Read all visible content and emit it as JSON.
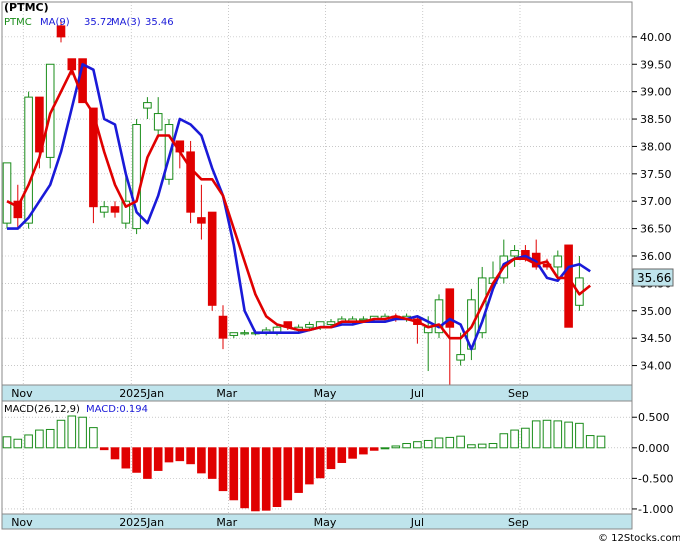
{
  "chart_data": [
    {
      "type": "candlestick",
      "ticker": "(PTMC)",
      "legend": {
        "symbol": "PTMC",
        "ma9_label": "MA(9)",
        "ma9_value": "35.72",
        "ma3_label": "MA(3)",
        "ma3_value": "35.46"
      },
      "last_price": "35.66",
      "ylim": [
        33.7,
        40.6
      ],
      "yticks": [
        "40.00",
        "39.50",
        "39.00",
        "38.50",
        "38.00",
        "37.50",
        "37.00",
        "36.50",
        "36.00",
        "35.50",
        "35.00",
        "34.50",
        "34.00"
      ],
      "month_labels": [
        "Nov",
        "2025Jan",
        "Mar",
        "May",
        "Jul",
        "Sep"
      ],
      "month_positions": [
        1.5,
        11.5,
        20.5,
        29.5,
        38.5,
        47.5
      ],
      "candles": [
        {
          "o": 36.6,
          "h": 37.7,
          "l": 36.5,
          "c": 37.7
        },
        {
          "o": 37.0,
          "h": 37.3,
          "l": 36.5,
          "c": 36.7
        },
        {
          "o": 36.6,
          "h": 39.0,
          "l": 36.5,
          "c": 38.9
        },
        {
          "o": 38.9,
          "h": 38.9,
          "l": 37.6,
          "c": 37.9
        },
        {
          "o": 37.8,
          "h": 39.5,
          "l": 37.6,
          "c": 39.5
        },
        {
          "o": 40.2,
          "h": 40.3,
          "l": 39.9,
          "c": 40.0
        },
        {
          "o": 39.6,
          "h": 39.6,
          "l": 39.3,
          "c": 39.4
        },
        {
          "o": 39.6,
          "h": 39.6,
          "l": 38.8,
          "c": 38.8
        },
        {
          "o": 38.7,
          "h": 38.7,
          "l": 36.6,
          "c": 36.9
        },
        {
          "o": 36.8,
          "h": 37.0,
          "l": 36.7,
          "c": 36.9
        },
        {
          "o": 36.9,
          "h": 37.0,
          "l": 36.7,
          "c": 36.8
        },
        {
          "o": 36.6,
          "h": 37.5,
          "l": 36.5,
          "c": 37.0
        },
        {
          "o": 36.5,
          "h": 38.5,
          "l": 36.4,
          "c": 38.4
        },
        {
          "o": 38.7,
          "h": 38.9,
          "l": 38.5,
          "c": 38.8
        },
        {
          "o": 38.3,
          "h": 38.9,
          "l": 38.2,
          "c": 38.6
        },
        {
          "o": 37.4,
          "h": 38.5,
          "l": 37.3,
          "c": 38.4
        },
        {
          "o": 38.1,
          "h": 38.1,
          "l": 37.6,
          "c": 37.9
        },
        {
          "o": 37.9,
          "h": 38.1,
          "l": 36.6,
          "c": 36.8
        },
        {
          "o": 36.7,
          "h": 37.3,
          "l": 36.3,
          "c": 36.6
        },
        {
          "o": 36.8,
          "h": 36.8,
          "l": 35.0,
          "c": 35.1
        },
        {
          "o": 34.9,
          "h": 35.1,
          "l": 34.3,
          "c": 34.5
        },
        {
          "o": 34.55,
          "h": 34.6,
          "l": 34.5,
          "c": 34.6
        },
        {
          "o": 34.6,
          "h": 34.65,
          "l": 34.55,
          "c": 34.6
        },
        {
          "o": 34.6,
          "h": 34.65,
          "l": 34.55,
          "c": 34.6
        },
        {
          "o": 34.6,
          "h": 34.7,
          "l": 34.55,
          "c": 34.65
        },
        {
          "o": 34.6,
          "h": 34.75,
          "l": 34.55,
          "c": 34.7
        },
        {
          "o": 34.8,
          "h": 34.8,
          "l": 34.65,
          "c": 34.7
        },
        {
          "o": 34.65,
          "h": 34.75,
          "l": 34.6,
          "c": 34.7
        },
        {
          "o": 34.7,
          "h": 34.8,
          "l": 34.65,
          "c": 34.75
        },
        {
          "o": 34.7,
          "h": 34.8,
          "l": 34.65,
          "c": 34.8
        },
        {
          "o": 34.75,
          "h": 34.85,
          "l": 34.7,
          "c": 34.8
        },
        {
          "o": 34.8,
          "h": 34.9,
          "l": 34.75,
          "c": 34.85
        },
        {
          "o": 34.8,
          "h": 34.9,
          "l": 34.75,
          "c": 34.85
        },
        {
          "o": 34.85,
          "h": 34.9,
          "l": 34.8,
          "c": 34.85
        },
        {
          "o": 34.85,
          "h": 34.9,
          "l": 34.8,
          "c": 34.9
        },
        {
          "o": 34.85,
          "h": 34.95,
          "l": 34.8,
          "c": 34.9
        },
        {
          "o": 34.9,
          "h": 34.95,
          "l": 34.8,
          "c": 34.85
        },
        {
          "o": 34.85,
          "h": 34.95,
          "l": 34.8,
          "c": 34.9
        },
        {
          "o": 34.85,
          "h": 34.9,
          "l": 34.4,
          "c": 34.75
        },
        {
          "o": 34.6,
          "h": 34.9,
          "l": 33.9,
          "c": 34.7
        },
        {
          "o": 34.6,
          "h": 35.3,
          "l": 34.5,
          "c": 35.2
        },
        {
          "o": 35.4,
          "h": 35.4,
          "l": 33.6,
          "c": 34.7
        },
        {
          "o": 34.1,
          "h": 34.6,
          "l": 34.0,
          "c": 34.2
        },
        {
          "o": 34.3,
          "h": 35.4,
          "l": 34.1,
          "c": 35.2
        },
        {
          "o": 34.6,
          "h": 35.8,
          "l": 34.5,
          "c": 35.6
        },
        {
          "o": 35.5,
          "h": 35.9,
          "l": 35.4,
          "c": 35.6
        },
        {
          "o": 35.6,
          "h": 36.3,
          "l": 35.5,
          "c": 36.0
        },
        {
          "o": 36.0,
          "h": 36.2,
          "l": 35.8,
          "c": 36.1
        },
        {
          "o": 36.1,
          "h": 36.2,
          "l": 35.9,
          "c": 35.95
        },
        {
          "o": 36.05,
          "h": 36.3,
          "l": 35.75,
          "c": 35.8
        },
        {
          "o": 35.85,
          "h": 35.95,
          "l": 35.75,
          "c": 35.8
        },
        {
          "o": 35.8,
          "h": 36.1,
          "l": 35.6,
          "c": 36.0
        },
        {
          "o": 36.2,
          "h": 36.2,
          "l": 34.7,
          "c": 34.7
        },
        {
          "o": 35.1,
          "h": 36.0,
          "l": 35.0,
          "c": 35.6
        }
      ],
      "series": [
        {
          "name": "MA(9)",
          "color": "#1a1ad8",
          "values": [
            36.5,
            36.5,
            36.7,
            37.0,
            37.3,
            37.9,
            38.7,
            39.5,
            39.4,
            38.5,
            38.4,
            37.5,
            36.8,
            36.6,
            37.1,
            37.8,
            38.5,
            38.4,
            38.2,
            37.6,
            37.1,
            36.2,
            35.0,
            34.6,
            34.6,
            34.6,
            34.6,
            34.6,
            34.65,
            34.7,
            34.7,
            34.75,
            34.75,
            34.8,
            34.8,
            34.8,
            34.85,
            34.85,
            34.9,
            34.8,
            34.7,
            34.85,
            34.75,
            34.3,
            34.8,
            35.4,
            35.85,
            35.95,
            36.0,
            35.9,
            35.6,
            35.55,
            35.8,
            35.85,
            35.72
          ]
        },
        {
          "name": "MA(3)",
          "color": "#e00000",
          "values": [
            37.0,
            36.9,
            37.3,
            37.8,
            38.6,
            39.0,
            39.4,
            38.9,
            38.6,
            37.9,
            37.3,
            36.9,
            37.0,
            37.8,
            38.2,
            38.2,
            37.9,
            37.6,
            37.4,
            37.4,
            37.1,
            36.5,
            35.9,
            35.3,
            34.9,
            34.75,
            34.7,
            34.65,
            34.65,
            34.7,
            34.7,
            34.8,
            34.8,
            34.8,
            34.85,
            34.85,
            34.9,
            34.85,
            34.8,
            34.7,
            34.75,
            34.5,
            34.5,
            34.7,
            35.1,
            35.5,
            35.8,
            35.95,
            35.95,
            35.85,
            35.9,
            35.6,
            35.6,
            35.3,
            35.46
          ]
        }
      ]
    },
    {
      "type": "bar",
      "legend": {
        "label": "MACD(26,12,9)",
        "value_label": "MACD:0.194"
      },
      "ylim": [
        -1.05,
        0.7
      ],
      "yticks": [
        "0.500",
        "0.000",
        "-0.500",
        "-1.000"
      ],
      "month_labels": [
        "Nov",
        "2025Jan",
        "Mar",
        "May",
        "Jul",
        "Sep"
      ],
      "month_positions": [
        1.5,
        11.5,
        20.5,
        29.5,
        38.5,
        47.5
      ],
      "values": [
        0.18,
        0.14,
        0.21,
        0.29,
        0.3,
        0.45,
        0.52,
        0.5,
        0.33,
        -0.03,
        -0.18,
        -0.33,
        -0.4,
        -0.5,
        -0.37,
        -0.23,
        -0.21,
        -0.26,
        -0.41,
        -0.5,
        -0.7,
        -0.85,
        -0.98,
        -1.03,
        -1.02,
        -0.96,
        -0.85,
        -0.73,
        -0.59,
        -0.49,
        -0.34,
        -0.24,
        -0.17,
        -0.1,
        -0.04,
        0.0,
        0.03,
        0.07,
        0.1,
        0.12,
        0.16,
        0.17,
        0.19,
        0.05,
        0.06,
        0.07,
        0.23,
        0.29,
        0.32,
        0.44,
        0.45,
        0.44,
        0.42,
        0.4,
        0.2,
        0.19
      ]
    }
  ],
  "footer": "© 12Stocks.com",
  "colors": {
    "up": "#1a8c1a",
    "down": "#e00000",
    "axis_band": "#bfe4ec",
    "grid": "#a8a8a8"
  }
}
